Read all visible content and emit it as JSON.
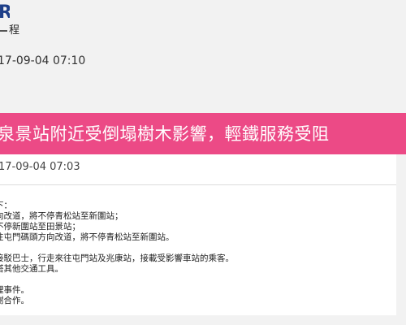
{
  "header": {
    "logo_text": "R",
    "logo_tail": "程",
    "timestamp": "17-09-04 07:10"
  },
  "notice": {
    "title": "泉景站附近受倒塌樹木影響，輕鐵服務受阻",
    "published": "17-09-04 07:03",
    "lines": [
      "下：",
      "向改道，將不停青松站至新圍站；",
      "不停新圍站至田景站；",
      "往屯門碼頭方向改道，將不停青松站至新圍站。",
      "",
      "接駁巴士，行走來往屯門站及兆康站，接載受影響車站的乘客。",
      "搭其他交通工具。",
      "",
      "理事件。",
      "謝合作。"
    ]
  },
  "colors": {
    "banner": "#ec4a86",
    "logo": "#1d3e88",
    "background": "#f2f2f2"
  }
}
